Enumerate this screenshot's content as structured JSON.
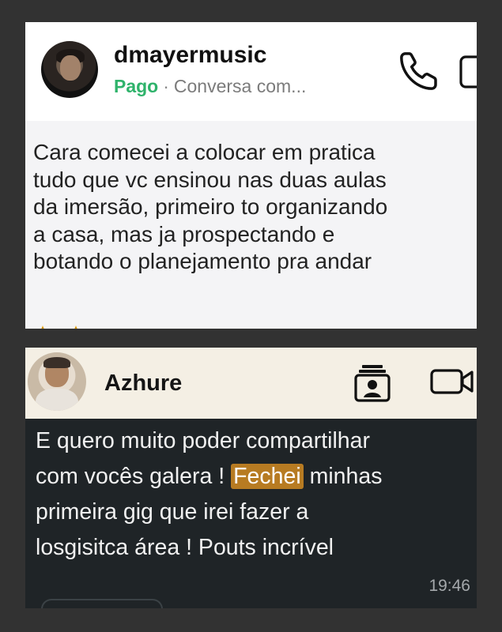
{
  "chat1": {
    "contact_name": "dmayermusic",
    "badge": "Pago",
    "separator": "·",
    "subtitle": "Conversa com...",
    "icons": {
      "call": "phone-icon",
      "video": "video-call-icon"
    },
    "message_lines": [
      "Cara comecei a colocar em pratica",
      "tudo que vc ensinou nas duas aulas",
      "da imersão, primeiro to organizando",
      "a casa, mas ja prospectando e",
      "botando o planejamento pra andar"
    ],
    "emoji": "🙏🙏",
    "colors": {
      "badge": "#2fb36b"
    }
  },
  "chat2": {
    "contact_name": "Azhure",
    "icons": {
      "contact": "contact-card-icon",
      "video": "video-call-icon"
    },
    "message": {
      "line1": "E quero muito poder compartilhar",
      "line2_before": "com vocês galera ! ",
      "line2_highlight": "Fechei",
      "line2_after": " minhas",
      "line3": "primeira gig que irei fazer a",
      "line4": "losgisitca área ! Pouts incrível"
    },
    "time": "19:46",
    "colors": {
      "highlight": "#b77b22",
      "bubble": "#1f2427"
    }
  }
}
